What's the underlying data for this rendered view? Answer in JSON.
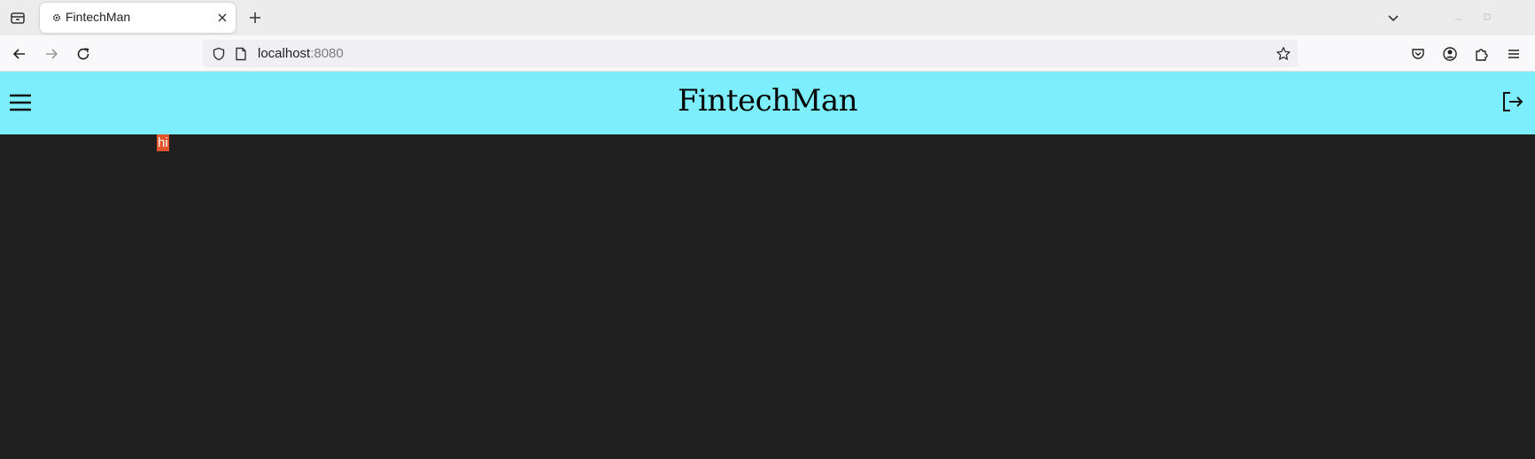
{
  "browser": {
    "tab": {
      "title": "FintechMan",
      "favicon": "gear-icon"
    },
    "url": {
      "host": "localhost",
      "port": ":8080"
    },
    "icons": {
      "tab_list": "tab-list-icon",
      "new_tab": "plus-icon",
      "tabs_overflow": "chevron-down-icon",
      "back": "arrow-left-icon",
      "forward": "arrow-right-icon",
      "reload": "reload-icon",
      "shield": "shield-icon",
      "page": "page-icon",
      "bookmark": "star-icon",
      "pocket": "pocket-icon",
      "account": "account-icon",
      "extensions": "puzzle-icon",
      "menu": "menu-icon"
    }
  },
  "app": {
    "brand": "FintechMan",
    "header_color": "#7deefe",
    "content_text": "hi",
    "highlight_color": "#e2542a",
    "icons": {
      "menu": "hamburger-icon",
      "logout": "logout-icon"
    }
  }
}
